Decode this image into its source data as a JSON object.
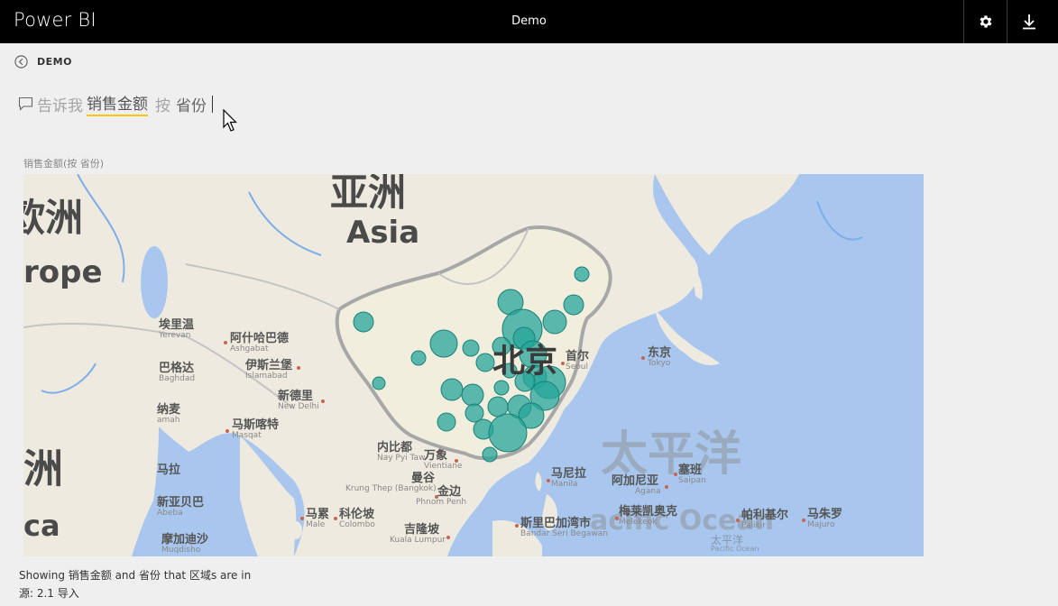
{
  "header": {
    "app_name": "Power BI",
    "report_title": "Demo",
    "settings_icon": "gear-icon",
    "download_icon": "download-icon"
  },
  "breadcrumb": {
    "back_icon": "back-arrow-circle-icon",
    "label": "DEMO"
  },
  "qa": {
    "icon": "speech-bubble-icon",
    "prompt": "告诉我",
    "term": "销售金额",
    "connector": "按",
    "field": "省份",
    "underline_color": "#f2c811"
  },
  "visual": {
    "title": "销售金额(按 省份)",
    "bubble_color": "#26a69a",
    "map_labels": {
      "asia_cn": "亚洲",
      "asia_en": "Asia",
      "europe_cn": "欧洲",
      "europe_en": "rope",
      "africa_cn": "洲",
      "africa_en": "ca",
      "pacific_cn": "太平洋",
      "pacific_en": "acific Ocean",
      "pacific_small_cn": "太平洋",
      "pacific_small_en": "Pacific Ocean",
      "beijing_cn": "北京",
      "cities": [
        {
          "cn": "埃里温",
          "en": "Yerevan"
        },
        {
          "cn": "阿什哈巴德",
          "en": "Ashgabat"
        },
        {
          "cn": "巴格达",
          "en": "Baghdad"
        },
        {
          "cn": "伊斯兰堡",
          "en": "Islamabad"
        },
        {
          "cn": "新德里",
          "en": "New Delhi"
        },
        {
          "cn": "纳麦",
          "en": "amah"
        },
        {
          "cn": "马斯喀特",
          "en": "Masqat"
        },
        {
          "cn": "马拉",
          "en": ""
        },
        {
          "cn": "新亚贝巴",
          "en": "Abeba"
        },
        {
          "cn": "摩加迪沙",
          "en": "Muqdisho"
        },
        {
          "cn": "马累",
          "en": "Male"
        },
        {
          "cn": "科伦坡",
          "en": "Colombo"
        },
        {
          "cn": "内比都",
          "en": "Nay Pyi Taw"
        },
        {
          "cn": "万象",
          "en": "Vientiane"
        },
        {
          "cn": "曼谷",
          "en": "Krung Thep (Bangkok)"
        },
        {
          "cn": "金边",
          "en": "Phnom Penh"
        },
        {
          "cn": "吉隆坡",
          "en": "Kuala Lumpur"
        },
        {
          "cn": "斯里巴加湾市",
          "en": "Bandar Seri Begawan"
        },
        {
          "cn": "马尼拉",
          "en": "Manila"
        },
        {
          "cn": "阿加尼亚",
          "en": "Agana"
        },
        {
          "cn": "塞班",
          "en": "Saipan"
        },
        {
          "cn": "梅莱凯奥克",
          "en": "Melekeok"
        },
        {
          "cn": "帕利基尔",
          "en": "Palikir"
        },
        {
          "cn": "马朱罗",
          "en": "Majuro"
        },
        {
          "cn": "首尔",
          "en": "Seoul"
        },
        {
          "cn": "东京",
          "en": "Tokyo"
        }
      ]
    }
  },
  "footer": {
    "description": "Showing 销售金额 and 省份 that 区域s are in",
    "source": "源: 2.1 导入"
  }
}
